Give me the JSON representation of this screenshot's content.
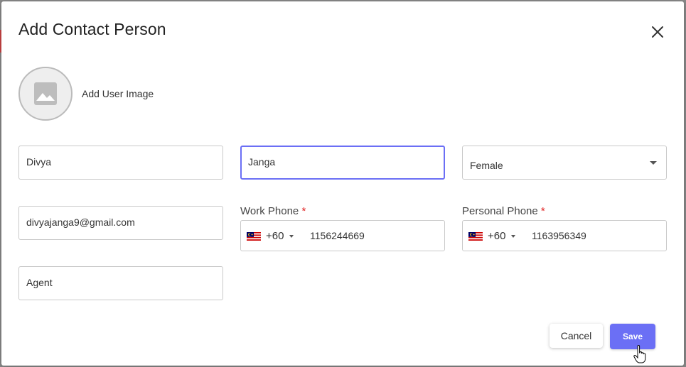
{
  "dialog": {
    "title": "Add Contact Person",
    "avatar_label": "Add User Image"
  },
  "form": {
    "first_name": "Divya",
    "last_name": "Janga",
    "gender": "Female",
    "email": "divyajanga9@gmail.com",
    "role": "Agent",
    "work_phone": {
      "label": "Work Phone",
      "required_mark": "*",
      "dial_code": "+60",
      "number": "1156244669"
    },
    "personal_phone": {
      "label": "Personal Phone",
      "required_mark": "*",
      "dial_code": "+60",
      "number": "1163956349"
    }
  },
  "actions": {
    "cancel": "Cancel",
    "save": "Save"
  },
  "colors": {
    "accent": "#6b6ff5",
    "required": "#e02424"
  }
}
